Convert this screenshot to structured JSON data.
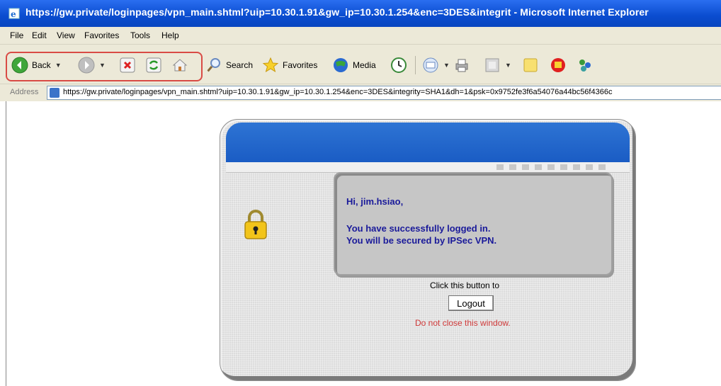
{
  "window": {
    "title": "https://gw.private/loginpages/vpn_main.shtml?uip=10.30.1.91&gw_ip=10.30.1.254&enc=3DES&integrit - Microsoft Internet Explorer"
  },
  "menu": [
    "File",
    "Edit",
    "View",
    "Favorites",
    "Tools",
    "Help"
  ],
  "toolbar": {
    "back_label": "Back",
    "search_label": "Search",
    "favorites_label": "Favorites",
    "media_label": "Media",
    "highlight_color": "#d94b45"
  },
  "address": {
    "label": "Address",
    "url": "https://gw.private/loginpages/vpn_main.shtml?uip=10.30.1.91&gw_ip=10.30.1.254&enc=3DES&integrity=SHA1&dh=1&psk=0x9752fe3f6a54076a44bc56f4366c"
  },
  "page": {
    "greeting": "Hi, jim.hsiao,",
    "success_line": "You have successfully logged in.",
    "secured_line": "You will be secured by IPSec VPN.",
    "click_text": "Click this button to",
    "logout_label": "Logout",
    "warning_text": "Do not close this window.",
    "colors": {
      "header_blue": "#1a5cc4",
      "message_text": "#1a1a9a",
      "warning": "#d03a3a"
    }
  }
}
